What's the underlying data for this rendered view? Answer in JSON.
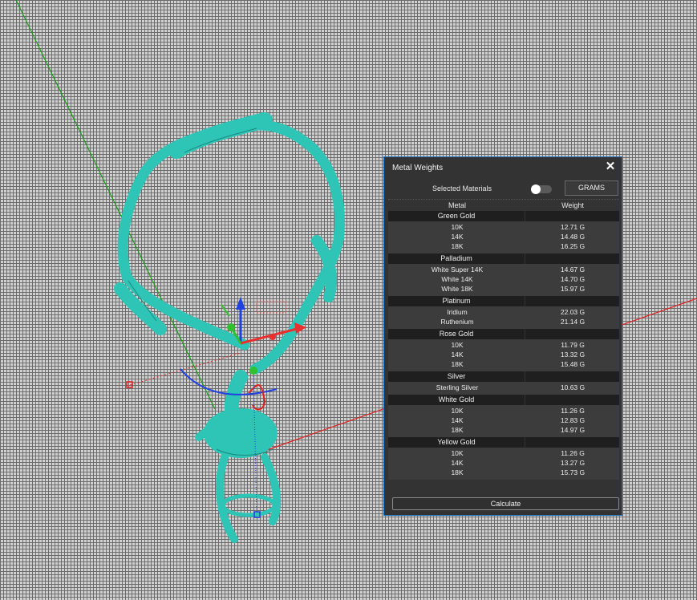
{
  "panel": {
    "title": "Metal Weights",
    "selected_materials_label": "Selected Materials",
    "selected_materials_on": false,
    "units_button": "GRAMS",
    "col_metal": "Metal",
    "col_weight": "Weight",
    "calculate_label": "Calculate",
    "groups": [
      {
        "name": "Green Gold",
        "items": [
          {
            "name": "10K",
            "weight": "12.71 G"
          },
          {
            "name": "14K",
            "weight": "14.48 G"
          },
          {
            "name": "18K",
            "weight": "16.25 G"
          }
        ]
      },
      {
        "name": "Palladium",
        "items": [
          {
            "name": "White Super 14K",
            "weight": "14.67 G"
          },
          {
            "name": "White 14K",
            "weight": "14.70 G"
          },
          {
            "name": "White 18K",
            "weight": "15.97 G"
          }
        ]
      },
      {
        "name": "Platinum",
        "items": [
          {
            "name": "Iridium",
            "weight": "22.03 G"
          },
          {
            "name": "Ruthenium",
            "weight": "21.14 G"
          }
        ]
      },
      {
        "name": "Rose Gold",
        "items": [
          {
            "name": "10K",
            "weight": "11.79 G"
          },
          {
            "name": "14K",
            "weight": "13.32 G"
          },
          {
            "name": "18K",
            "weight": "15.48 G"
          }
        ]
      },
      {
        "name": "Silver",
        "items": [
          {
            "name": "Sterling Silver",
            "weight": "10.63 G"
          }
        ]
      },
      {
        "name": "White Gold",
        "items": [
          {
            "name": "10K",
            "weight": "11.26 G"
          },
          {
            "name": "14K",
            "weight": "12.83 G"
          },
          {
            "name": "18K",
            "weight": "14.97 G"
          }
        ]
      },
      {
        "name": "Yellow Gold",
        "items": [
          {
            "name": "10K",
            "weight": "11.26 G"
          },
          {
            "name": "14K",
            "weight": "13.27 G"
          },
          {
            "name": "18K",
            "weight": "15.73 G"
          }
        ]
      }
    ]
  },
  "viewport": {
    "model_color": "#2ec4b6",
    "x_axis_color": "#e02020",
    "y_axis_color": "#1a9a1a",
    "gizmo_x_color": "#e83030",
    "gizmo_y_color": "#30c030",
    "gizmo_z_color": "#2040e0"
  },
  "icons": {
    "close": "close-icon"
  }
}
